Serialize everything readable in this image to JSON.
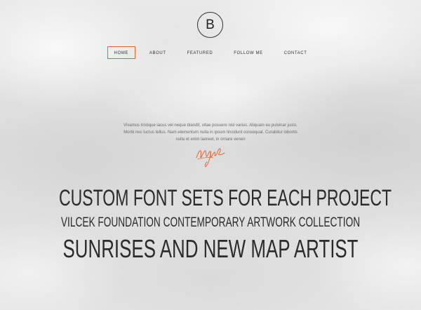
{
  "logo": {
    "letter": "B"
  },
  "nav": {
    "items": [
      {
        "label": "HOME",
        "active": true
      },
      {
        "label": "ABOUT",
        "active": false
      },
      {
        "label": "FEATURED",
        "active": false
      },
      {
        "label": "FOLLOW ME",
        "active": false
      },
      {
        "label": "CONTACT",
        "active": false
      }
    ]
  },
  "intro": {
    "text": "Vivamus tristique lacus vel neque blandit, vitae posuere nisl varius. Aliquam eu pulvinar justo. Morbi nec luctus tellus. Nam elementum nulla in ipsum tincidunt consequat. Curabitur lobortis nulla et enim laoreet, in ornare venen"
  },
  "headlines": {
    "line1": "CUSTOM FONT SETS FOR EACH PROJECT",
    "line2": "VILCEK FOUNDATION CONTEMPORARY ARTWORK COLLECTION",
    "line3": "SUNRISES AND NEW MAP ARTIST"
  },
  "colors": {
    "accent": "#e2652e",
    "text": "#2b2b2b",
    "background": "#e6e6e6"
  }
}
